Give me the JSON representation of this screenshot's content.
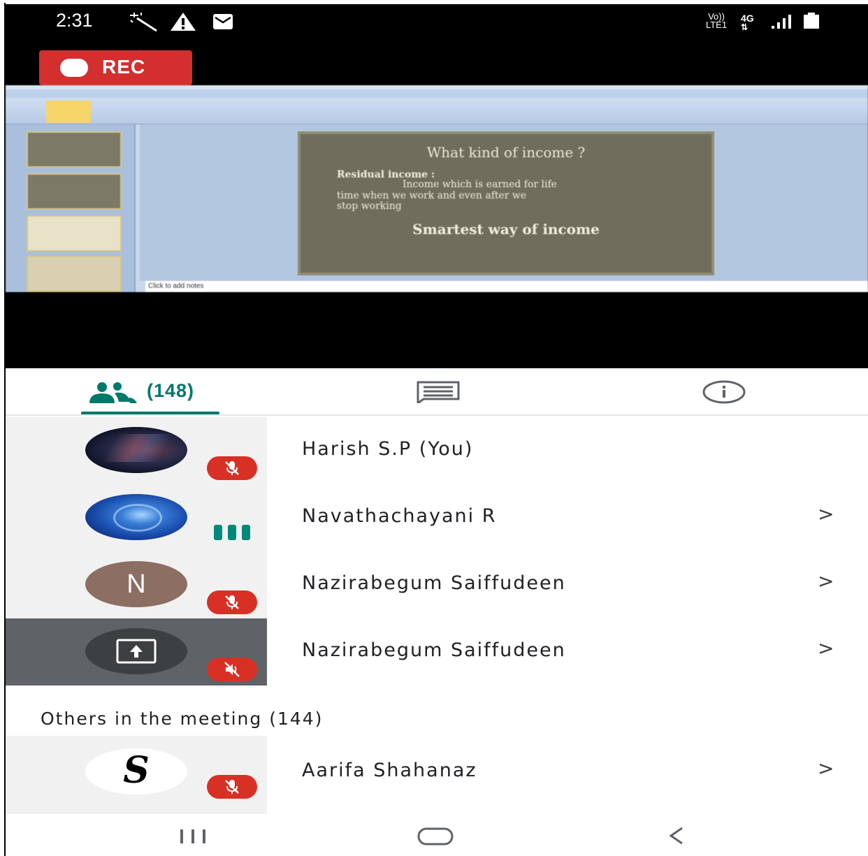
{
  "status_bar": {
    "time": "2:31",
    "left_icons": [
      "sparkle-icon",
      "warning-icon",
      "mail-icon"
    ],
    "network_label": "Vo)) LTE1",
    "signal_label": "4G"
  },
  "recording": {
    "label": "REC"
  },
  "shared_screen": {
    "slide_title": "What kind of income ?",
    "slide_line1": "Residual income :",
    "slide_line2": "Income which is earned for life",
    "slide_line3": "time when we work and even after we",
    "slide_line4": "stop working",
    "slide_emphasis": "Smartest way of income",
    "notes_placeholder": "Click to add notes"
  },
  "tabs": {
    "people_count": "(148)",
    "people_icon": "people-icon",
    "chat_icon": "chat-icon",
    "info_icon": "info-icon"
  },
  "participants": [
    {
      "name": "Harish S.P (You)",
      "avatar": "galaxy-photo",
      "status": "muted"
    },
    {
      "name": "Navathachayani R",
      "avatar": "blue-rose-photo",
      "status": "speaking"
    },
    {
      "name": "Nazirabegum Saiffudeen",
      "avatar_letter": "N",
      "status": "muted"
    },
    {
      "name": "Nazirabegum Saiffudeen",
      "avatar": "screen-share-icon",
      "status": "audio-off"
    }
  ],
  "others": {
    "title": "Others in the meeting (144)",
    "items": [
      {
        "name": "Aarifa Shahanaz",
        "avatar_letter": "S",
        "status": "muted"
      }
    ]
  },
  "colors": {
    "accent": "#00796b",
    "muted_badge": "#d93025",
    "speaking": "#00897b"
  }
}
